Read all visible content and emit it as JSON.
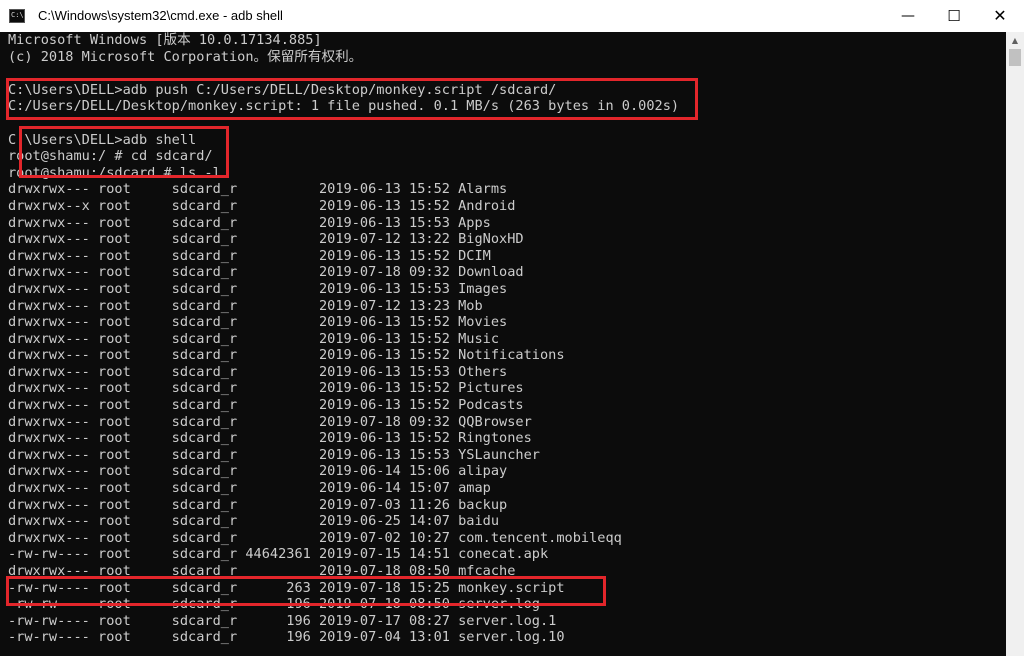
{
  "window": {
    "title": "C:\\Windows\\system32\\cmd.exe - adb  shell",
    "app_icon": "console-icon",
    "minimize_icon": "minimize-icon",
    "maximize_icon": "maximize-icon",
    "close_icon": "close-icon"
  },
  "console": {
    "lines": [
      "Microsoft Windows [版本 10.0.17134.885]",
      "(c) 2018 Microsoft Corporation。保留所有权利。",
      "",
      "C:\\Users\\DELL>adb push C:/Users/DELL/Desktop/monkey.script /sdcard/",
      "C:/Users/DELL/Desktop/monkey.script: 1 file pushed. 0.1 MB/s (263 bytes in 0.002s)",
      "",
      "C:\\Users\\DELL>adb shell",
      "root@shamu:/ # cd sdcard/",
      "root@shamu:/sdcard # ls -l",
      "drwxrwx--- root     sdcard_r          2019-06-13 15:52 Alarms",
      "drwxrwx--x root     sdcard_r          2019-06-13 15:52 Android",
      "drwxrwx--- root     sdcard_r          2019-06-13 15:53 Apps",
      "drwxrwx--- root     sdcard_r          2019-07-12 13:22 BigNoxHD",
      "drwxrwx--- root     sdcard_r          2019-06-13 15:52 DCIM",
      "drwxrwx--- root     sdcard_r          2019-07-18 09:32 Download",
      "drwxrwx--- root     sdcard_r          2019-06-13 15:53 Images",
      "drwxrwx--- root     sdcard_r          2019-07-12 13:23 Mob",
      "drwxrwx--- root     sdcard_r          2019-06-13 15:52 Movies",
      "drwxrwx--- root     sdcard_r          2019-06-13 15:52 Music",
      "drwxrwx--- root     sdcard_r          2019-06-13 15:52 Notifications",
      "drwxrwx--- root     sdcard_r          2019-06-13 15:53 Others",
      "drwxrwx--- root     sdcard_r          2019-06-13 15:52 Pictures",
      "drwxrwx--- root     sdcard_r          2019-06-13 15:52 Podcasts",
      "drwxrwx--- root     sdcard_r          2019-07-18 09:32 QQBrowser",
      "drwxrwx--- root     sdcard_r          2019-06-13 15:52 Ringtones",
      "drwxrwx--- root     sdcard_r          2019-06-13 15:53 YSLauncher",
      "drwxrwx--- root     sdcard_r          2019-06-14 15:06 alipay",
      "drwxrwx--- root     sdcard_r          2019-06-14 15:07 amap",
      "drwxrwx--- root     sdcard_r          2019-07-03 11:26 backup",
      "drwxrwx--- root     sdcard_r          2019-06-25 14:07 baidu",
      "drwxrwx--- root     sdcard_r          2019-07-02 10:27 com.tencent.mobileqq",
      "-rw-rw---- root     sdcard_r 44642361 2019-07-15 14:51 conecat.apk",
      "drwxrwx--- root     sdcard_r          2019-07-18 08:50 mfcache",
      "-rw-rw---- root     sdcard_r      263 2019-07-18 15:25 monkey.script",
      "-rw-rw---- root     sdcard_r      196 2019-07-18 08:50 server.log",
      "-rw-rw---- root     sdcard_r      196 2019-07-17 08:27 server.log.1",
      "-rw-rw---- root     sdcard_r      196 2019-07-04 13:01 server.log.10"
    ]
  },
  "scrollbar": {
    "up_icon": "scroll-up-arrow-icon"
  },
  "colors": {
    "console_background": "#0c0c0c",
    "console_text": "#cccccc",
    "highlight_border": "#e3262b"
  }
}
